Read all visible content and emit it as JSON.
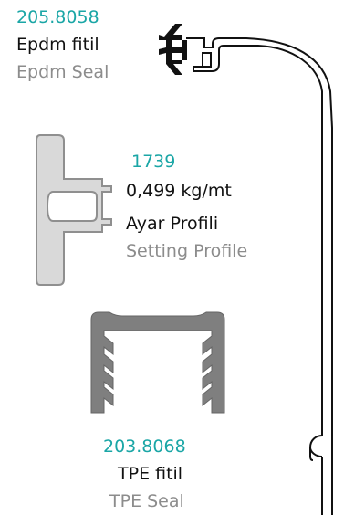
{
  "colors": {
    "accent": "#1aa6a6",
    "primary_text": "#111111",
    "secondary_text": "#8c8c8c",
    "profile_fill": "#d9d9d9",
    "profile_stroke": "#8f8f8f",
    "dark_profile": "#7f7f7f"
  },
  "items": [
    {
      "code": "205.8058",
      "name_tr": "Epdm fitil",
      "name_en": "Epdm Seal",
      "icon": "epdm-seal-icon"
    },
    {
      "code": "1739",
      "weight": "0,499 kg/mt",
      "name_tr": "Ayar Profili",
      "name_en": "Setting Profile",
      "icon": "setting-profile-icon"
    },
    {
      "code": "203.8068",
      "name_tr": "TPE fitil",
      "name_en": "TPE Seal",
      "icon": "tpe-seal-icon"
    }
  ]
}
